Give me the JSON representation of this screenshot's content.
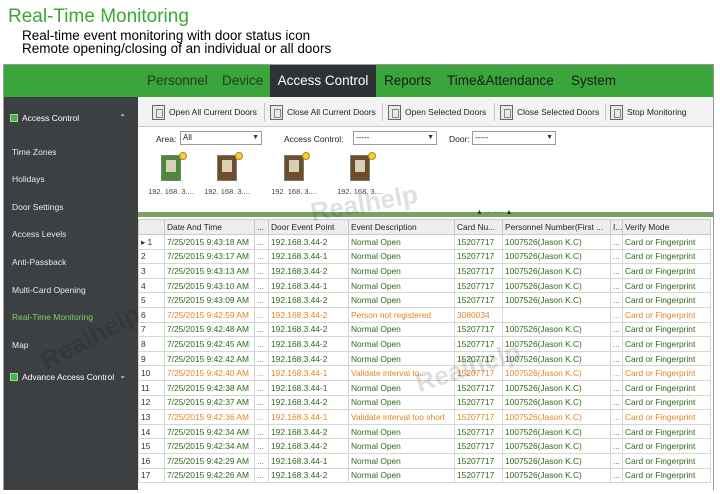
{
  "caption": {
    "title": "Real-Time Monitoring",
    "line1": "Real-time event monitoring with door status icon",
    "line2": "Remote opening/closing of an individual or all doors"
  },
  "nav": {
    "items": [
      "Personnel",
      "Device",
      "Access Control",
      "Reports",
      "Time&Attendance",
      "System"
    ],
    "active": "Access Control"
  },
  "sidebar": {
    "header": "Access Control",
    "header_chevron": "⌃",
    "items": [
      "Time Zones",
      "Holidays",
      "Door Settings",
      "Access Levels",
      "Anti-Passback",
      "Multi-Card Opening",
      "Real-Time Monitoring",
      "Map"
    ],
    "active": "Real-Time Monitoring",
    "footer": "Advance Access Control",
    "footer_chevron": "⌄"
  },
  "toolbar": {
    "open_all": "Open All Current Doors",
    "close_all": "Close All Current Doors",
    "open_selected": "Open Selected Doors",
    "close_selected": "Close Selected Doors",
    "stop": "Stop Monitoring"
  },
  "filters": {
    "area_label": "Area",
    "area_value": "All",
    "ac_label": "Access Control",
    "ac_value": "-----",
    "door_label": "Door",
    "door_value": "-----"
  },
  "doors": [
    {
      "label": "192. 168. 3....",
      "state": "open"
    },
    {
      "label": "192. 168. 3....",
      "state": "closed"
    },
    {
      "label": "192. 168. 3....",
      "state": "closed"
    },
    {
      "label": "192. 168. 3....",
      "state": "closed"
    }
  ],
  "table": {
    "columns": [
      "",
      "Date And Time",
      "...",
      "Door Event Point",
      "Event Description",
      "Card Nu...",
      "Personnel Number(First ...",
      "I...",
      "Verify Mode"
    ],
    "rows": [
      {
        "n": "▸ 1",
        "date": "7/25/2015 9:43:18 AM",
        "door": "192.168.3.44-2",
        "desc": "Normal Open",
        "card": "15207717",
        "person": "1007526(Jason K.C)",
        "mode": "Card or Fingerprint",
        "warn": false
      },
      {
        "n": "2",
        "date": "7/25/2015 9:43:17 AM",
        "door": "192.168.3.44-1",
        "desc": "Normal Open",
        "card": "15207717",
        "person": "1007526(Jason K.C)",
        "mode": "Card or Fingerprint",
        "warn": false
      },
      {
        "n": "3",
        "date": "7/25/2015 9:43:13 AM",
        "door": "192.168.3.44-2",
        "desc": "Normal Open",
        "card": "15207717",
        "person": "1007526(Jason K.C)",
        "mode": "Card or Fingerprint",
        "warn": false
      },
      {
        "n": "4",
        "date": "7/25/2015 9:43:10 AM",
        "door": "192.168.3.44-1",
        "desc": "Normal Open",
        "card": "15207717",
        "person": "1007526(Jason K.C)",
        "mode": "Card or Fingerprint",
        "warn": false
      },
      {
        "n": "5",
        "date": "7/25/2015 9:43:09 AM",
        "door": "192.168.3.44-2",
        "desc": "Normal Open",
        "card": "15207717",
        "person": "1007526(Jason K.C)",
        "mode": "Card or Fingerprint",
        "warn": false
      },
      {
        "n": "6",
        "date": "7/25/2015 9:42:59 AM",
        "door": "192.168.3.44-2",
        "desc": "Person not registered",
        "card": "3080034",
        "person": "",
        "mode": "Card or Fingerprint",
        "warn": true
      },
      {
        "n": "7",
        "date": "7/25/2015 9:42:48 AM",
        "door": "192.168.3.44-2",
        "desc": "Normal Open",
        "card": "15207717",
        "person": "1007526(Jason K.C)",
        "mode": "Card or Fingerprint",
        "warn": false
      },
      {
        "n": "8",
        "date": "7/25/2015 9:42:45 AM",
        "door": "192.168.3.44-2",
        "desc": "Normal Open",
        "card": "15207717",
        "person": "1007526(Jason K.C)",
        "mode": "Card or Fingerprint",
        "warn": false
      },
      {
        "n": "9",
        "date": "7/25/2015 9:42:42 AM",
        "door": "192.168.3.44-2",
        "desc": "Normal Open",
        "card": "15207717",
        "person": "1007526(Jason K.C)",
        "mode": "Card or Fingerprint",
        "warn": false
      },
      {
        "n": "10",
        "date": "7/25/2015 9:42:40 AM",
        "door": "192.168.3.44-1",
        "desc": "Validate interval to...",
        "card": "15207717",
        "person": "1007526(Jason K.C)",
        "mode": "Card or Fingerprint",
        "warn": true
      },
      {
        "n": "11",
        "date": "7/25/2015 9:42:38 AM",
        "door": "192.168.3.44-1",
        "desc": "Normal Open",
        "card": "15207717",
        "person": "1007526(Jason K.C)",
        "mode": "Card or Fingerprint",
        "warn": false
      },
      {
        "n": "12",
        "date": "7/25/2015 9:42:37 AM",
        "door": "192.168.3.44-2",
        "desc": "Normal Open",
        "card": "15207717",
        "person": "1007526(Jason K.C)",
        "mode": "Card or Fingerprint",
        "warn": false
      },
      {
        "n": "13",
        "date": "7/25/2015 9:42:36 AM",
        "door": "192.168.3.44-1",
        "desc": "Validate interval too short",
        "card": "15207717",
        "person": "1007526(Jason K.C)",
        "mode": "Card or Fingerprint",
        "warn": true
      },
      {
        "n": "14",
        "date": "7/25/2015 9:42:34 AM",
        "door": "192.168.3.44-2",
        "desc": "Normal Open",
        "card": "15207717",
        "person": "1007526(Jason K.C)",
        "mode": "Card or Fingerprint",
        "warn": false
      },
      {
        "n": "15",
        "date": "7/25/2015 9:42:34 AM",
        "door": "192.168.3.44-2",
        "desc": "Normal Open",
        "card": "15207717",
        "person": "1007526(Jason K.C)",
        "mode": "Card or Fingerprint",
        "warn": false
      },
      {
        "n": "16",
        "date": "7/25/2015 9:42:29 AM",
        "door": "192.168.3.44-1",
        "desc": "Normal Open",
        "card": "15207717",
        "person": "1007526(Jason K.C)",
        "mode": "Card or Fingerprint",
        "warn": false
      },
      {
        "n": "17",
        "date": "7/25/2015 9:42:26 AM",
        "door": "192.168.3.44-2",
        "desc": "Normal Open",
        "card": "15207717",
        "person": "1007526(Jason K.C)",
        "mode": "Card or Fingerprint",
        "warn": false
      }
    ],
    "dots": "..."
  },
  "watermark": "Realhelp",
  "colors": {
    "nav_green": "#3aa53a",
    "active_nav": "#2e3234",
    "sidebar_bg": "#3c4043",
    "normal_row_text": "#2c6a1a",
    "warning_row_text": "#e2861f"
  }
}
